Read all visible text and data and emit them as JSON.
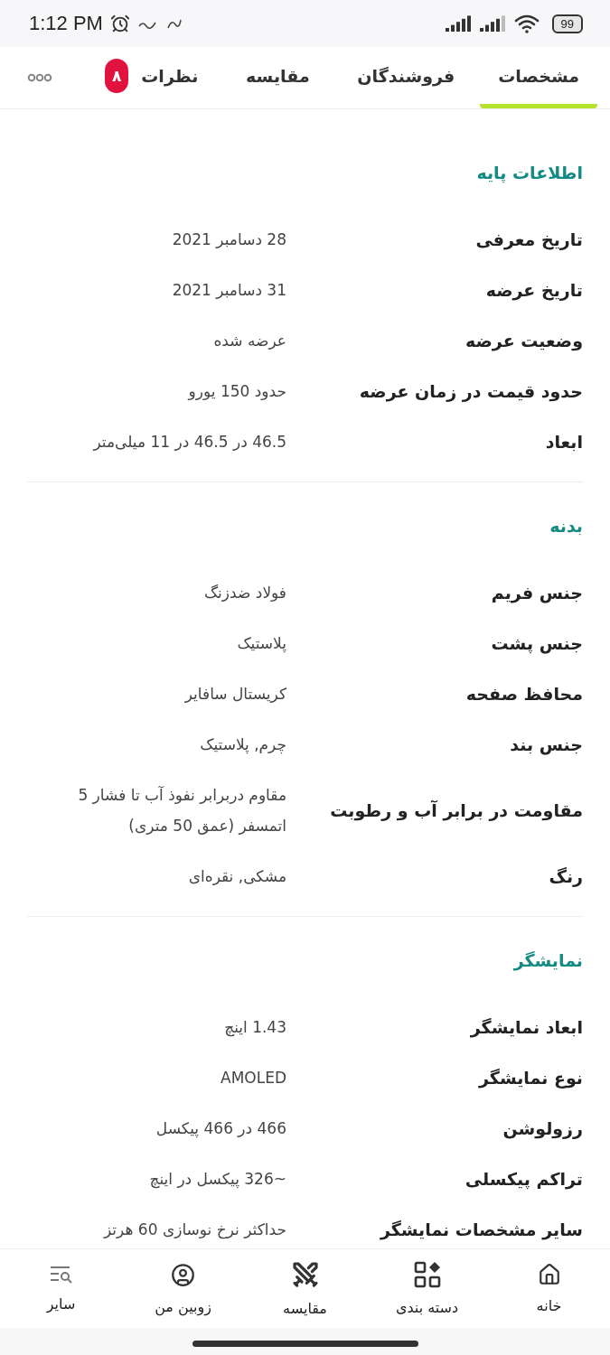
{
  "status_bar": {
    "time": "1:12 PM",
    "battery": "99"
  },
  "tabs": [
    {
      "label": "مشخصات",
      "selected": true
    },
    {
      "label": "فروشندگان",
      "selected": false
    },
    {
      "label": "مقایسه",
      "selected": false
    },
    {
      "label": "نظرات",
      "selected": false,
      "badge": "۸"
    }
  ],
  "sections": [
    {
      "title": "اطلاعات پایه",
      "rows": [
        {
          "label": "تاریخ معرفی",
          "value": "28 دسامبر 2021"
        },
        {
          "label": "تاریخ عرضه",
          "value": "31 دسامبر 2021"
        },
        {
          "label": "وضعیت عرضه",
          "value": "عرضه شده"
        },
        {
          "label": "حدود قیمت در زمان عرضه",
          "value": "حدود 150 یورو"
        },
        {
          "label": "ابعاد",
          "value": "46.5 در 46.5 در 11 میلی‌متر"
        }
      ]
    },
    {
      "title": "بدنه",
      "rows": [
        {
          "label": "جنس فریم",
          "value": "فولاد ضدزنگ"
        },
        {
          "label": "جنس پشت",
          "value": "پلاستیک"
        },
        {
          "label": "محافظ صفحه",
          "value": "کریستال سافایر"
        },
        {
          "label": "جنس بند",
          "value": "چرم, پلاستیک"
        },
        {
          "label": "مقاومت در برابر آب و رطوبت",
          "value": "مقاوم دربرابر نفوذ آب تا فشار 5 اتمسفر (عمق 50 متری)"
        },
        {
          "label": "رنگ",
          "value": "مشکی, نقره‌ای"
        }
      ]
    },
    {
      "title": "نمایشگر",
      "rows": [
        {
          "label": "ابعاد نمایشگر",
          "value": "1.43 اینچ"
        },
        {
          "label": "نوع نمایشگر",
          "value": "AMOLED"
        },
        {
          "label": "رزولوشن",
          "value": "466 در 466 پیکسل"
        },
        {
          "label": "تراکم پیکسلی",
          "value": "~326 پیکسل در اینچ"
        },
        {
          "label": "سایر مشخصات نمایشگر",
          "value": "حداکثر نرخ نوسازی 60 هرتز"
        }
      ]
    }
  ],
  "bottom_nav": [
    {
      "kind": "home",
      "label": "خانه"
    },
    {
      "kind": "grid",
      "label": "دسته بندی"
    },
    {
      "kind": "swords",
      "label": "مقایسه"
    },
    {
      "kind": "user",
      "label": "زوبین من"
    },
    {
      "kind": "search-list",
      "label": "سایر"
    }
  ]
}
